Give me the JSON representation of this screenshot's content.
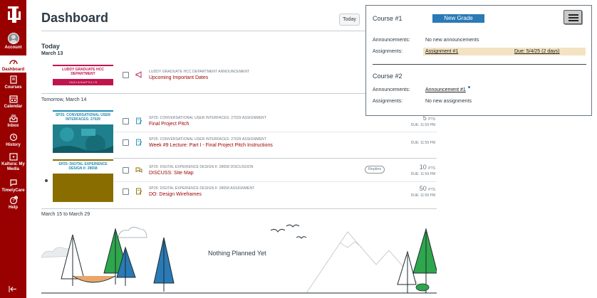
{
  "nav": {
    "items": [
      {
        "label": "Account",
        "icon": "account-avatar"
      },
      {
        "label": "Dashboard",
        "icon": "dashboard-icon"
      },
      {
        "label": "Courses",
        "icon": "courses-icon"
      },
      {
        "label": "Calendar",
        "icon": "calendar-icon"
      },
      {
        "label": "Inbox",
        "icon": "inbox-icon"
      },
      {
        "label": "History",
        "icon": "history-icon"
      },
      {
        "label": "Kaltura: My Media",
        "icon": "kaltura-icon"
      },
      {
        "label": "TimelyCare",
        "icon": "timelycare-icon"
      },
      {
        "label": "Help",
        "icon": "help-icon"
      }
    ],
    "help_badge": "1",
    "collapse_icon": "collapse-arrow-icon"
  },
  "header": {
    "title": "Dashboard",
    "today_button": "Today"
  },
  "days": [
    {
      "heading": "Today",
      "date": "March 13"
    },
    {
      "heading": "Tomorrow, March 14"
    },
    {
      "heading": "March 15 to March 29"
    }
  ],
  "courses": [
    {
      "card_label": "LUDDY GRADUATE HCC DEPARTMENT",
      "card_sub": "I N D I A N A P O L I S",
      "color": "#c0144d"
    },
    {
      "card_label": "SP25: CONVERSATIONAL USER INTERFACES: 27029",
      "color": "#1f8ab2"
    },
    {
      "card_label": "SP25: DIGITAL EXPERIENCE DESIGN II: 28658",
      "color": "#8a6d00"
    }
  ],
  "items": [
    {
      "meta": "LUDDY GRADUATE HCC DEPARTMENT ANNOUNCEMENT",
      "name": "Upcoming Important Dates",
      "icon": "announcement-icon"
    },
    {
      "meta": "SP25: CONVERSATIONAL USER INTERFACES: 27029 ASSIGNMENT",
      "name": "Final Project Pitch",
      "pts": "5",
      "pts_unit": "PTS",
      "due": "DUE: 11:59 PM",
      "icon": "assignment-icon"
    },
    {
      "meta": "SP25: CONVERSATIONAL USER INTERFACES: 27029 ASSIGNMENT",
      "name": "Week #9 Lecture: Part I - Final Project Pitch Instructions",
      "due": "DUE: 11:59 PM",
      "icon": "assignment-icon"
    },
    {
      "meta": "SP25: DIGITAL EXPERIENCE DESIGN II: 28658 DISCUSSION",
      "name": "DISCUSS: Site Map",
      "pts": "10",
      "pts_unit": "PTS",
      "due": "DUE: 11:59 PM",
      "replies": "Replies",
      "icon": "discussion-icon"
    },
    {
      "meta": "SP25: DIGITAL EXPERIENCE DESIGN II: 28658 ASSIGNMENT",
      "name": "DO: Design Wireframes",
      "pts": "50",
      "pts_unit": "PTS",
      "due": "DUE: 11:59 PM",
      "icon": "assignment-icon"
    }
  ],
  "empty_state": "Nothing Planned Yet",
  "popup": {
    "course1": "Course #1",
    "new_grade": "New Grade",
    "announcements_label": "Announcements:",
    "assignments_label": "Assignments:",
    "course1_announcements": "No new announcements",
    "course1_assignment": "Assignment #1",
    "course1_due": "Due: 5/4/25 (2 days)",
    "course2": "Course #2",
    "course2_announcement": "Announcement #1",
    "course2_assignments": "No new assignments",
    "menu_icon": "hamburger-menu-icon"
  },
  "colors": {
    "nav_bg": "#990000",
    "link_red": "#990000",
    "new_grade_blue": "#2a7ab5",
    "assignment_highlight": "#f3e3c3"
  }
}
